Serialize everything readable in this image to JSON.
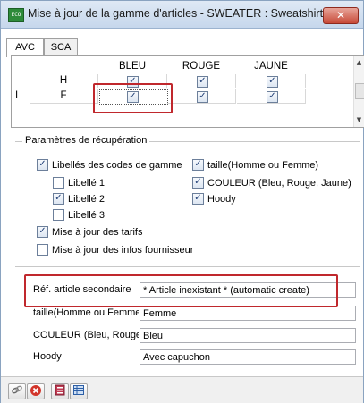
{
  "window": {
    "title": "Mise à jour de la gamme d'articles - SWEATER : Sweatshirt",
    "app_icon_text": "ECO",
    "close_label": "✕"
  },
  "tabs": [
    {
      "label": "AVC",
      "active": true
    },
    {
      "label": "SCA",
      "active": false
    }
  ],
  "grid": {
    "columns": [
      "BLEU",
      "ROUGE",
      "JAUNE"
    ],
    "rows": [
      {
        "label": "H",
        "values": [
          true,
          true,
          true
        ]
      },
      {
        "label": "F",
        "values": [
          true,
          true,
          true
        ]
      }
    ],
    "cursor": "I"
  },
  "params": {
    "title": "Paramètres de récupération",
    "left": [
      {
        "label": "Libellés des codes de gamme",
        "checked": true
      },
      {
        "label": "Libellé 1",
        "checked": false
      },
      {
        "label": "Libellé 2",
        "checked": true
      },
      {
        "label": "Libellé 3",
        "checked": false
      },
      {
        "label": "Mise à jour des tarifs",
        "checked": true
      },
      {
        "label": "Mise à jour des infos fournisseur",
        "checked": false
      }
    ],
    "right": [
      {
        "label": "taille(Homme ou Femme)",
        "checked": true
      },
      {
        "label": "COULEUR (Bleu, Rouge, Jaune)",
        "checked": true
      },
      {
        "label": "Hoody",
        "checked": true
      }
    ]
  },
  "fields": [
    {
      "label": "Réf. article secondaire",
      "value": "* Article inexistant *  (automatic create)"
    },
    {
      "label": "taille(Homme ou Femme)",
      "value": "Femme"
    },
    {
      "label": "COULEUR (Bleu, Rouge,",
      "value": "Bleu"
    },
    {
      "label": "Hoody",
      "value": "Avec capuchon"
    }
  ],
  "toolbar": {
    "icons": [
      "link-icon",
      "cancel-icon",
      "book-icon",
      "table-icon"
    ]
  },
  "colors": {
    "highlight": "#c0282d",
    "checkmark": "#1e3d75"
  }
}
